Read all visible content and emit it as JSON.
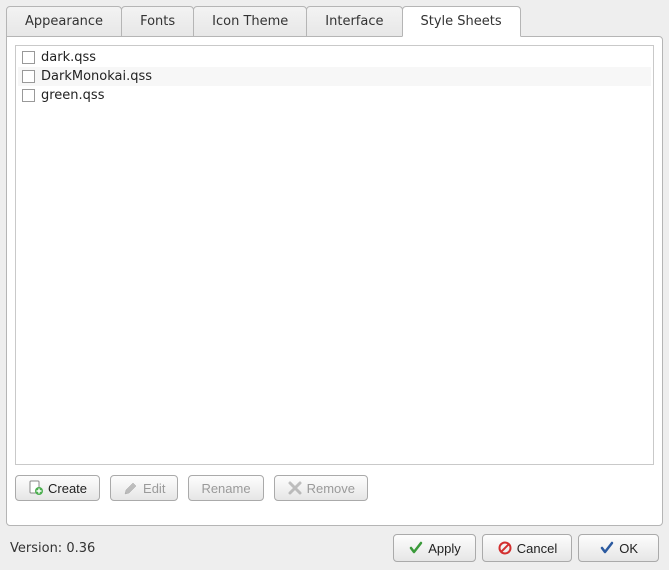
{
  "tabs": {
    "appearance": "Appearance",
    "fonts": "Fonts",
    "icon_theme": "Icon Theme",
    "interface": "Interface",
    "style_sheets": "Style Sheets"
  },
  "active_tab": "style_sheets",
  "stylesheets": [
    {
      "name": "dark.qss",
      "checked": false
    },
    {
      "name": "DarkMonokai.qss",
      "checked": false
    },
    {
      "name": "green.qss",
      "checked": false
    }
  ],
  "toolbar": {
    "create": "Create",
    "edit": "Edit",
    "rename": "Rename",
    "remove": "Remove"
  },
  "footer": {
    "version_label": "Version: 0.36",
    "apply": "Apply",
    "cancel": "Cancel",
    "ok": "OK"
  }
}
